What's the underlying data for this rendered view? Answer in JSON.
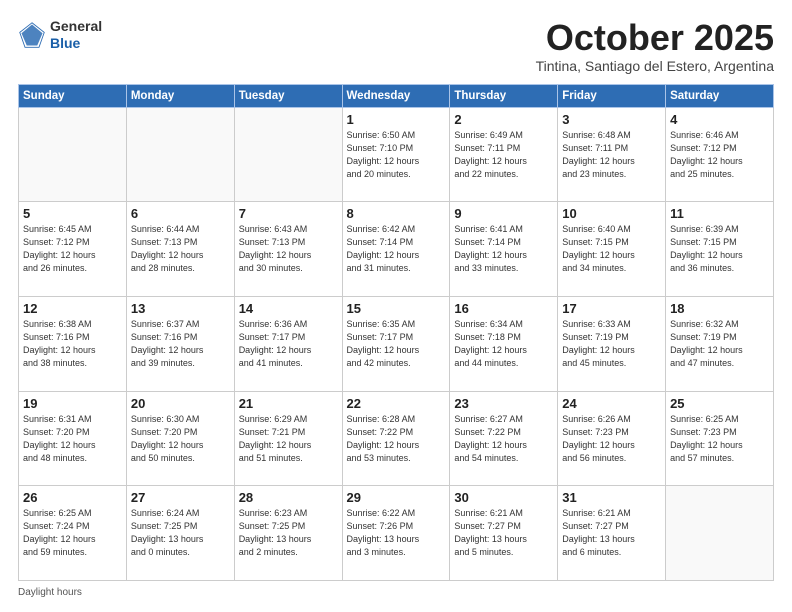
{
  "logo": {
    "general": "General",
    "blue": "Blue"
  },
  "header": {
    "month": "October 2025",
    "location": "Tintina, Santiago del Estero, Argentina"
  },
  "days_of_week": [
    "Sunday",
    "Monday",
    "Tuesday",
    "Wednesday",
    "Thursday",
    "Friday",
    "Saturday"
  ],
  "weeks": [
    [
      {
        "day": "",
        "info": ""
      },
      {
        "day": "",
        "info": ""
      },
      {
        "day": "",
        "info": ""
      },
      {
        "day": "1",
        "info": "Sunrise: 6:50 AM\nSunset: 7:10 PM\nDaylight: 12 hours\nand 20 minutes."
      },
      {
        "day": "2",
        "info": "Sunrise: 6:49 AM\nSunset: 7:11 PM\nDaylight: 12 hours\nand 22 minutes."
      },
      {
        "day": "3",
        "info": "Sunrise: 6:48 AM\nSunset: 7:11 PM\nDaylight: 12 hours\nand 23 minutes."
      },
      {
        "day": "4",
        "info": "Sunrise: 6:46 AM\nSunset: 7:12 PM\nDaylight: 12 hours\nand 25 minutes."
      }
    ],
    [
      {
        "day": "5",
        "info": "Sunrise: 6:45 AM\nSunset: 7:12 PM\nDaylight: 12 hours\nand 26 minutes."
      },
      {
        "day": "6",
        "info": "Sunrise: 6:44 AM\nSunset: 7:13 PM\nDaylight: 12 hours\nand 28 minutes."
      },
      {
        "day": "7",
        "info": "Sunrise: 6:43 AM\nSunset: 7:13 PM\nDaylight: 12 hours\nand 30 minutes."
      },
      {
        "day": "8",
        "info": "Sunrise: 6:42 AM\nSunset: 7:14 PM\nDaylight: 12 hours\nand 31 minutes."
      },
      {
        "day": "9",
        "info": "Sunrise: 6:41 AM\nSunset: 7:14 PM\nDaylight: 12 hours\nand 33 minutes."
      },
      {
        "day": "10",
        "info": "Sunrise: 6:40 AM\nSunset: 7:15 PM\nDaylight: 12 hours\nand 34 minutes."
      },
      {
        "day": "11",
        "info": "Sunrise: 6:39 AM\nSunset: 7:15 PM\nDaylight: 12 hours\nand 36 minutes."
      }
    ],
    [
      {
        "day": "12",
        "info": "Sunrise: 6:38 AM\nSunset: 7:16 PM\nDaylight: 12 hours\nand 38 minutes."
      },
      {
        "day": "13",
        "info": "Sunrise: 6:37 AM\nSunset: 7:16 PM\nDaylight: 12 hours\nand 39 minutes."
      },
      {
        "day": "14",
        "info": "Sunrise: 6:36 AM\nSunset: 7:17 PM\nDaylight: 12 hours\nand 41 minutes."
      },
      {
        "day": "15",
        "info": "Sunrise: 6:35 AM\nSunset: 7:17 PM\nDaylight: 12 hours\nand 42 minutes."
      },
      {
        "day": "16",
        "info": "Sunrise: 6:34 AM\nSunset: 7:18 PM\nDaylight: 12 hours\nand 44 minutes."
      },
      {
        "day": "17",
        "info": "Sunrise: 6:33 AM\nSunset: 7:19 PM\nDaylight: 12 hours\nand 45 minutes."
      },
      {
        "day": "18",
        "info": "Sunrise: 6:32 AM\nSunset: 7:19 PM\nDaylight: 12 hours\nand 47 minutes."
      }
    ],
    [
      {
        "day": "19",
        "info": "Sunrise: 6:31 AM\nSunset: 7:20 PM\nDaylight: 12 hours\nand 48 minutes."
      },
      {
        "day": "20",
        "info": "Sunrise: 6:30 AM\nSunset: 7:20 PM\nDaylight: 12 hours\nand 50 minutes."
      },
      {
        "day": "21",
        "info": "Sunrise: 6:29 AM\nSunset: 7:21 PM\nDaylight: 12 hours\nand 51 minutes."
      },
      {
        "day": "22",
        "info": "Sunrise: 6:28 AM\nSunset: 7:22 PM\nDaylight: 12 hours\nand 53 minutes."
      },
      {
        "day": "23",
        "info": "Sunrise: 6:27 AM\nSunset: 7:22 PM\nDaylight: 12 hours\nand 54 minutes."
      },
      {
        "day": "24",
        "info": "Sunrise: 6:26 AM\nSunset: 7:23 PM\nDaylight: 12 hours\nand 56 minutes."
      },
      {
        "day": "25",
        "info": "Sunrise: 6:25 AM\nSunset: 7:23 PM\nDaylight: 12 hours\nand 57 minutes."
      }
    ],
    [
      {
        "day": "26",
        "info": "Sunrise: 6:25 AM\nSunset: 7:24 PM\nDaylight: 12 hours\nand 59 minutes."
      },
      {
        "day": "27",
        "info": "Sunrise: 6:24 AM\nSunset: 7:25 PM\nDaylight: 13 hours\nand 0 minutes."
      },
      {
        "day": "28",
        "info": "Sunrise: 6:23 AM\nSunset: 7:25 PM\nDaylight: 13 hours\nand 2 minutes."
      },
      {
        "day": "29",
        "info": "Sunrise: 6:22 AM\nSunset: 7:26 PM\nDaylight: 13 hours\nand 3 minutes."
      },
      {
        "day": "30",
        "info": "Sunrise: 6:21 AM\nSunset: 7:27 PM\nDaylight: 13 hours\nand 5 minutes."
      },
      {
        "day": "31",
        "info": "Sunrise: 6:21 AM\nSunset: 7:27 PM\nDaylight: 13 hours\nand 6 minutes."
      },
      {
        "day": "",
        "info": ""
      }
    ]
  ],
  "footer": {
    "daylight_hours": "Daylight hours"
  }
}
